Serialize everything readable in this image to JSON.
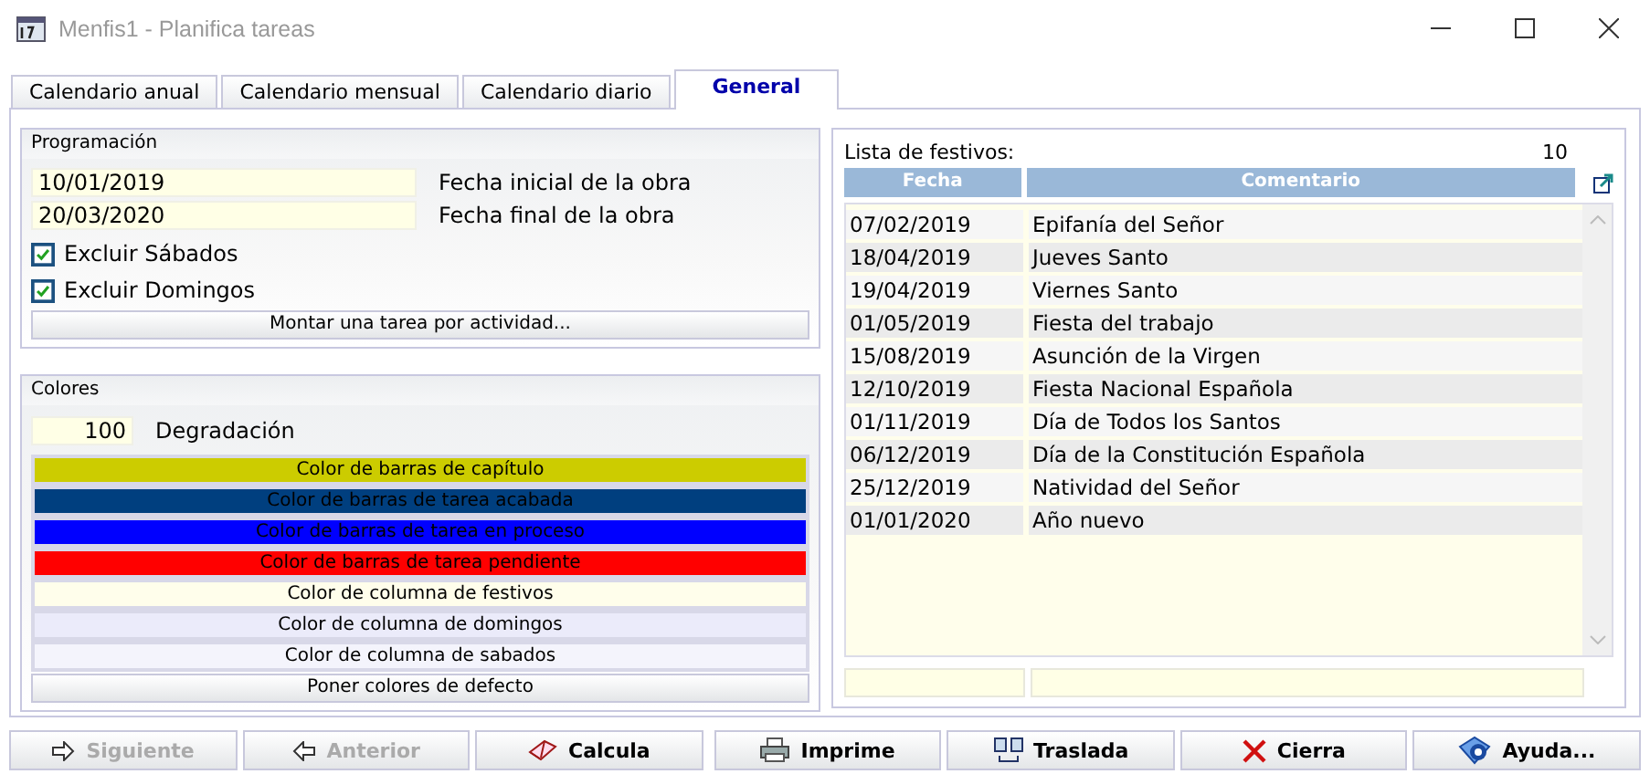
{
  "window": {
    "title": "Menfis1 - Planifica tareas"
  },
  "tabs": [
    {
      "label": "Calendario anual",
      "selected": false
    },
    {
      "label": "Calendario mensual",
      "selected": false
    },
    {
      "label": "Calendario diario",
      "selected": false
    },
    {
      "label": "General",
      "selected": true
    }
  ],
  "programacion": {
    "title": "Programación",
    "fields": [
      {
        "value": "10/01/2019",
        "label": "Fecha inicial de la obra"
      },
      {
        "value": "20/03/2020",
        "label": "Fecha final de la obra"
      }
    ],
    "checkboxes": [
      {
        "label": "Excluir Sábados",
        "checked": true
      },
      {
        "label": "Excluir Domingos",
        "checked": true
      }
    ],
    "button": "Montar una tarea por actividad..."
  },
  "colores": {
    "title": "Colores",
    "degradacion": {
      "value": "100",
      "label": "Degradación"
    },
    "color_buttons": [
      {
        "label": "Color de barras de capítulo",
        "color": "#cccc00"
      },
      {
        "label": "Color de barras de tarea acabada",
        "color": "#003f7f"
      },
      {
        "label": "Color de barras de tarea en proceso",
        "color": "#0000ff"
      },
      {
        "label": "Color de barras de tarea pendiente",
        "color": "#ff0000"
      },
      {
        "label": "Color de columna de festivos",
        "color": "#fffeeb"
      },
      {
        "label": "Color de columna de domingos",
        "color": "#ebebfa"
      },
      {
        "label": "Color de columna de sabados",
        "color": "#f4f4fc"
      }
    ],
    "default_button": "Poner colores de defecto"
  },
  "festivos": {
    "title": "Lista de festivos:",
    "count": "10",
    "columns": [
      "Fecha",
      "Comentario"
    ],
    "rows": [
      [
        "07/02/2019",
        "Epifanía del Señor"
      ],
      [
        "18/04/2019",
        "Jueves Santo"
      ],
      [
        "19/04/2019",
        "Viernes Santo"
      ],
      [
        "01/05/2019",
        "Fiesta del trabajo"
      ],
      [
        "15/08/2019",
        "Asunción de la Virgen"
      ],
      [
        "12/10/2019",
        "Fiesta Nacional Española"
      ],
      [
        "01/11/2019",
        "Día de Todos los Santos"
      ],
      [
        "06/12/2019",
        "Día de la Constitución Española"
      ],
      [
        "25/12/2019",
        "Natividad del Señor"
      ],
      [
        "01/01/2020",
        "Año nuevo"
      ]
    ]
  },
  "buttons": [
    {
      "label": "Siguiente",
      "disabled": true
    },
    {
      "label": "Anterior",
      "disabled": true
    },
    {
      "label": "Calcula",
      "disabled": false
    },
    {
      "label": "Imprime",
      "disabled": false
    },
    {
      "label": "Traslada",
      "disabled": false
    },
    {
      "label": "Cierra",
      "disabled": false
    },
    {
      "label": "Ayuda...",
      "disabled": false
    }
  ]
}
